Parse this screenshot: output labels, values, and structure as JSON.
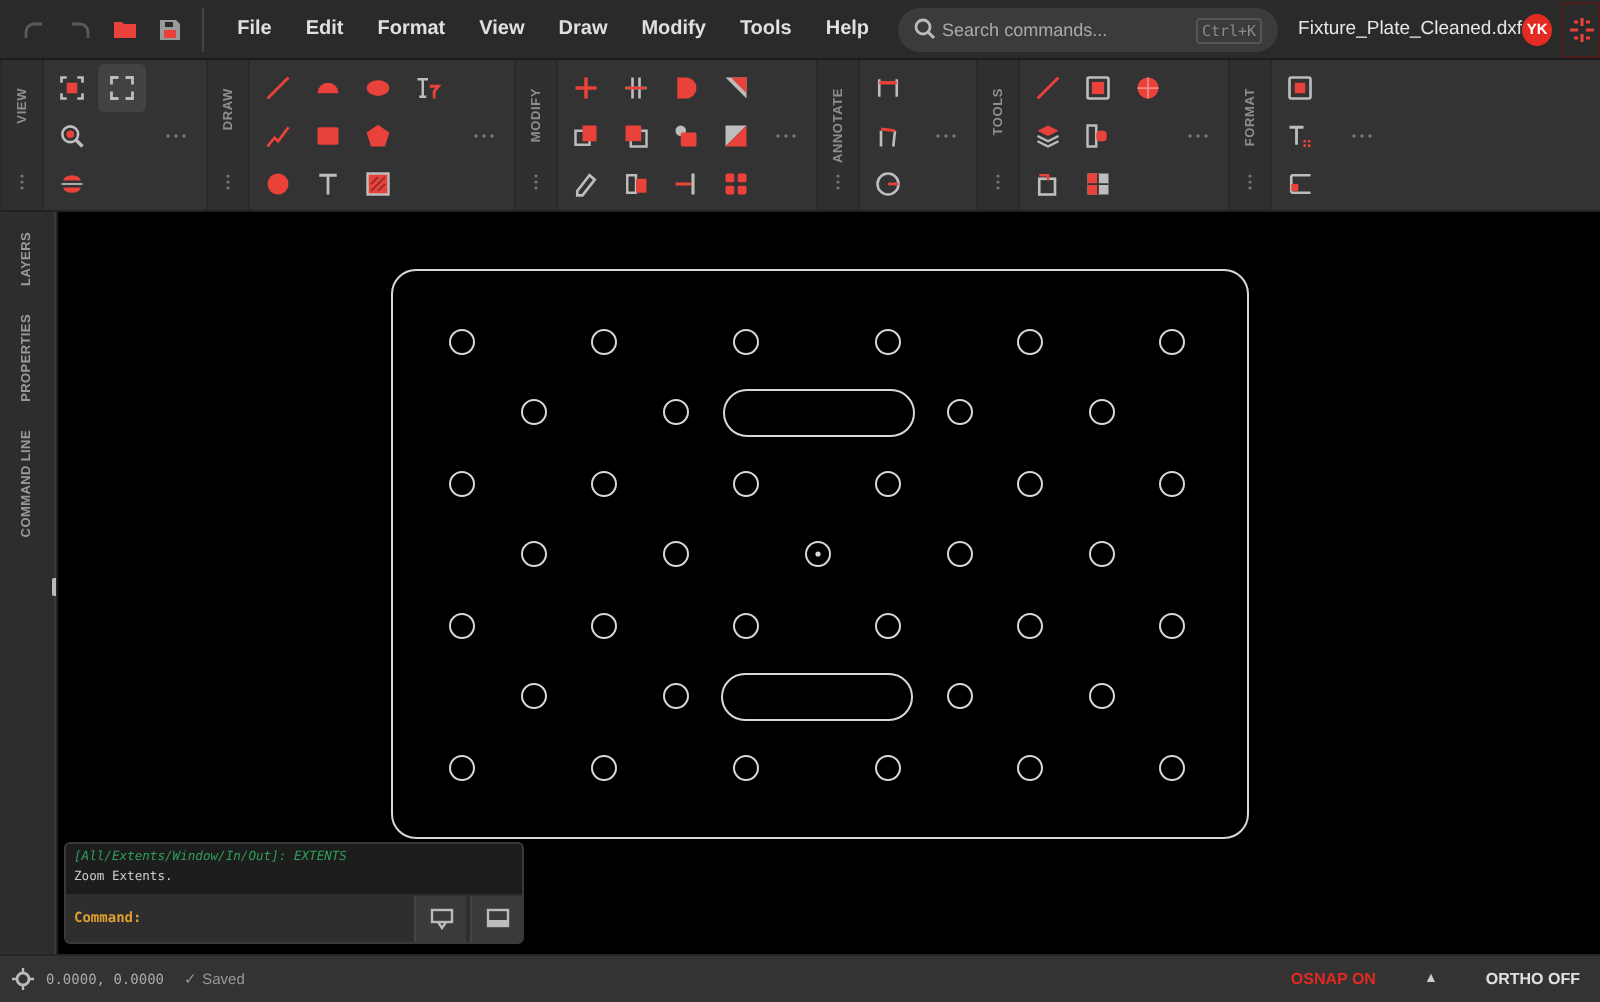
{
  "toolbar": {
    "undo": {
      "disabled": true
    },
    "redo": {
      "disabled": true
    }
  },
  "menu": [
    "File",
    "Edit",
    "Format",
    "View",
    "Draw",
    "Modify",
    "Tools",
    "Help"
  ],
  "search": {
    "placeholder": "Search commands...",
    "shortcut": "Ctrl+K"
  },
  "document_title": "Fixture_Plate_Cleaned.dxf",
  "user": {
    "initials": "YK"
  },
  "ribbon": [
    {
      "label": "VIEW",
      "tools": [
        {
          "selected": false
        },
        {
          "selected": false
        },
        {
          "selected": false
        },
        {
          "selected": true
        }
      ]
    },
    {
      "label": "DRAW",
      "tools": [
        {
          "selected": false
        },
        {
          "selected": false
        },
        {
          "selected": false
        },
        {
          "selected": false
        },
        {
          "selected": false
        },
        {
          "selected": false
        },
        {
          "selected": false
        },
        {
          "selected": false
        },
        {
          "selected": false
        },
        {
          "selected": false
        }
      ]
    },
    {
      "label": "MODIFY",
      "tools": [
        {
          "selected": false
        },
        {
          "selected": false
        },
        {
          "selected": false
        },
        {
          "selected": false
        },
        {
          "selected": false
        },
        {
          "selected": false
        },
        {
          "selected": false
        },
        {
          "selected": false
        },
        {
          "selected": false
        },
        {
          "selected": false
        },
        {
          "selected": false
        },
        {
          "selected": false
        }
      ]
    },
    {
      "label": "ANNOTATE",
      "tools": [
        {
          "selected": false
        },
        {
          "selected": false
        },
        {
          "selected": false
        }
      ]
    },
    {
      "label": "TOOLS",
      "tools": [
        {
          "selected": false
        },
        {
          "selected": false
        },
        {
          "selected": false
        },
        {
          "selected": false
        },
        {
          "selected": false
        },
        {
          "selected": false
        },
        {
          "selected": false
        }
      ]
    },
    {
      "label": "FORMAT",
      "tools": [
        {
          "selected": false
        },
        {
          "selected": false
        },
        {
          "selected": false
        }
      ]
    }
  ],
  "side_tabs": [
    "LAYERS",
    "PROPERTIES",
    "COMMAND LINE"
  ],
  "command_line": {
    "history": [
      "[All/Extents/Window/In/Out]: EXTENTS",
      "Zoom Extents."
    ],
    "prompt": "Command:"
  },
  "status_bar": {
    "coordinates": "0.0000, 0.0000",
    "save_status": "✓ Saved",
    "osnap": {
      "label": "OSNAP ON",
      "on": true
    },
    "toggle": "▲",
    "ortho": {
      "label": "ORTHO OFF",
      "on": false
    }
  }
}
